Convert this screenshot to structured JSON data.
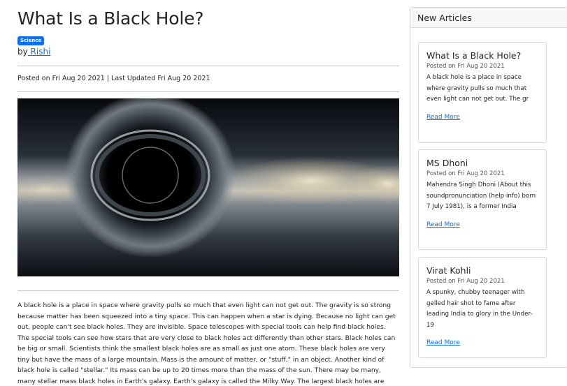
{
  "article": {
    "title": "What Is a Black Hole?",
    "category_badge": "Science",
    "by_label": "by",
    "author": " Rishi",
    "posted": "Posted on Fri Aug 20 2021 | Last Updated Fri Aug 20 2021",
    "body": "A black hole is a place in space where gravity pulls so much that even light can not get out. The gravity is so strong because matter has been squeezed into a tiny space. This can happen when a star is dying. Because no light can get out, people can't see black holes. They are invisible. Space telescopes with special tools can help find black holes. The special tools can see how stars that are very close to black holes act differently than other stars. Black holes can be big or small. Scientists think the smallest black holes are as small as just one atom. These black holes are very tiny but have the mass of a large mountain. Mass is the amount of matter, or \"stuff,\" in an object. Another kind of black hole is called \"stellar.\" Its mass can be up to 20 times more than the mass of the sun. There may be many, many stellar mass black holes in Earth's galaxy. Earth's galaxy is called the Milky Way. The largest black holes are called \"supermassive.\" These black holes have"
  },
  "sidebar": {
    "heading": "New Articles",
    "cards": [
      {
        "title": "What Is a Black Hole?",
        "date": "Posted on Fri Aug 20 2021",
        "excerpt": "A black hole is a place in space where gravity pulls so much that even light can not get out. The gr",
        "link": "Read More"
      },
      {
        "title": "MS Dhoni",
        "date": "Posted on Fri Aug 20 2021",
        "excerpt": "Mahendra Singh Dhoni (About this soundpronunciation (help·info) born 7 July 1981), is a former India",
        "link": "Read More"
      },
      {
        "title": "Virat Kohli",
        "date": "Posted on Fri Aug 20 2021",
        "excerpt": "A spunky, chubby teenager with gelled hair shot to fame after leading India to glory in the Under-19",
        "link": "Read More"
      }
    ]
  },
  "colors": {
    "link": "#0d6efd",
    "badge": "#0d6efd",
    "divider": "#c8c8c8"
  }
}
